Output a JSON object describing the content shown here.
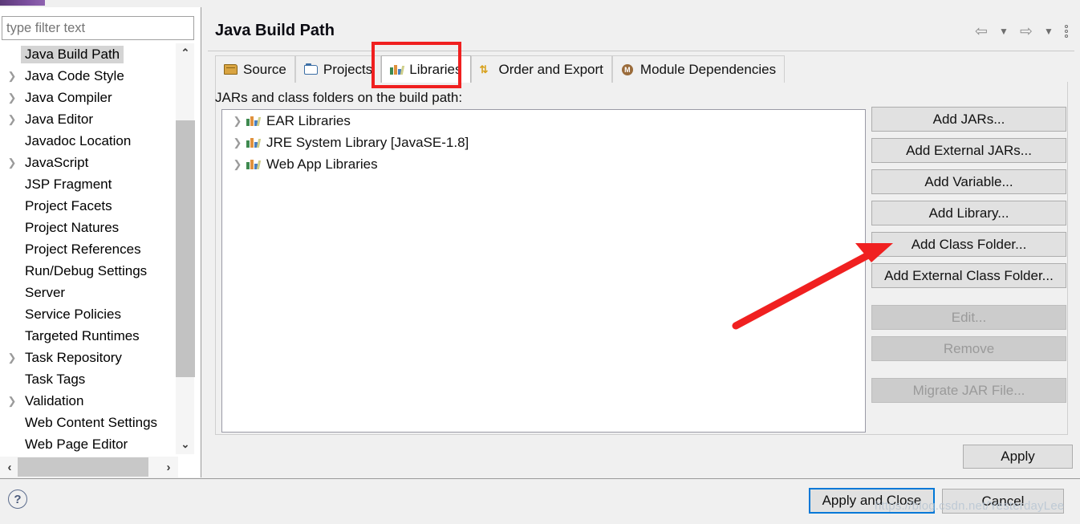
{
  "window": {
    "title": "Java Build Path"
  },
  "sidebar": {
    "filter_placeholder": "type filter text",
    "items": [
      {
        "label": "Java Build Path",
        "expandable": false,
        "selected": true
      },
      {
        "label": "Java Code Style",
        "expandable": true,
        "selected": false
      },
      {
        "label": "Java Compiler",
        "expandable": true,
        "selected": false
      },
      {
        "label": "Java Editor",
        "expandable": true,
        "selected": false
      },
      {
        "label": "Javadoc Location",
        "expandable": false,
        "selected": false
      },
      {
        "label": "JavaScript",
        "expandable": true,
        "selected": false
      },
      {
        "label": "JSP Fragment",
        "expandable": false,
        "selected": false
      },
      {
        "label": "Project Facets",
        "expandable": false,
        "selected": false
      },
      {
        "label": "Project Natures",
        "expandable": false,
        "selected": false
      },
      {
        "label": "Project References",
        "expandable": false,
        "selected": false
      },
      {
        "label": "Run/Debug Settings",
        "expandable": false,
        "selected": false
      },
      {
        "label": "Server",
        "expandable": false,
        "selected": false
      },
      {
        "label": "Service Policies",
        "expandable": false,
        "selected": false
      },
      {
        "label": "Targeted Runtimes",
        "expandable": false,
        "selected": false
      },
      {
        "label": "Task Repository",
        "expandable": true,
        "selected": false
      },
      {
        "label": "Task Tags",
        "expandable": false,
        "selected": false
      },
      {
        "label": "Validation",
        "expandable": true,
        "selected": false
      },
      {
        "label": "Web Content Settings",
        "expandable": false,
        "selected": false
      },
      {
        "label": "Web Page Editor",
        "expandable": false,
        "selected": false
      }
    ],
    "scroll": {
      "up_glyph": "⌃",
      "down_glyph": "⌄",
      "left_glyph": "‹",
      "right_glyph": "›"
    }
  },
  "nav": {
    "back_glyph": "⇦",
    "back_menu_glyph": "▼",
    "forward_glyph": "⇨",
    "forward_menu_glyph": "▼"
  },
  "tabs": [
    {
      "label": "Source",
      "icon": "package-icon",
      "active": false
    },
    {
      "label": "Projects",
      "icon": "folder-icon",
      "active": false
    },
    {
      "label": "Libraries",
      "icon": "books-icon",
      "active": true
    },
    {
      "label": "Order and Export",
      "icon": "order-icon",
      "active": false
    },
    {
      "label": "Module Dependencies",
      "icon": "module-icon",
      "active": false
    }
  ],
  "main": {
    "section_label": "JARs and class folders on the build path:",
    "library_items": [
      {
        "label": "EAR Libraries",
        "icon": "books-icon"
      },
      {
        "label": "JRE System Library [JavaSE-1.8]",
        "icon": "books-icon"
      },
      {
        "label": "Web App Libraries",
        "icon": "books-icon"
      }
    ],
    "buttons": [
      {
        "label": "Add JARs...",
        "enabled": true
      },
      {
        "label": "Add External JARs...",
        "enabled": true
      },
      {
        "label": "Add Variable...",
        "enabled": true
      },
      {
        "label": "Add Library...",
        "enabled": true
      },
      {
        "label": "Add Class Folder...",
        "enabled": true
      },
      {
        "label": "Add External Class Folder...",
        "enabled": true
      },
      {
        "label": "Edit...",
        "enabled": false
      },
      {
        "label": "Remove",
        "enabled": false
      },
      {
        "label": "Migrate JAR File...",
        "enabled": false
      }
    ],
    "apply_label": "Apply"
  },
  "footer": {
    "help_glyph": "?",
    "apply_and_close_label": "Apply and Close",
    "cancel_label": "Cancel"
  },
  "watermark": {
    "text": "https://blog.csdn.net/YesterdayLee"
  },
  "annotations": {
    "highlight_color": "#f02020",
    "arrow_color": "#f02020",
    "focus_color": "#0078d7"
  }
}
